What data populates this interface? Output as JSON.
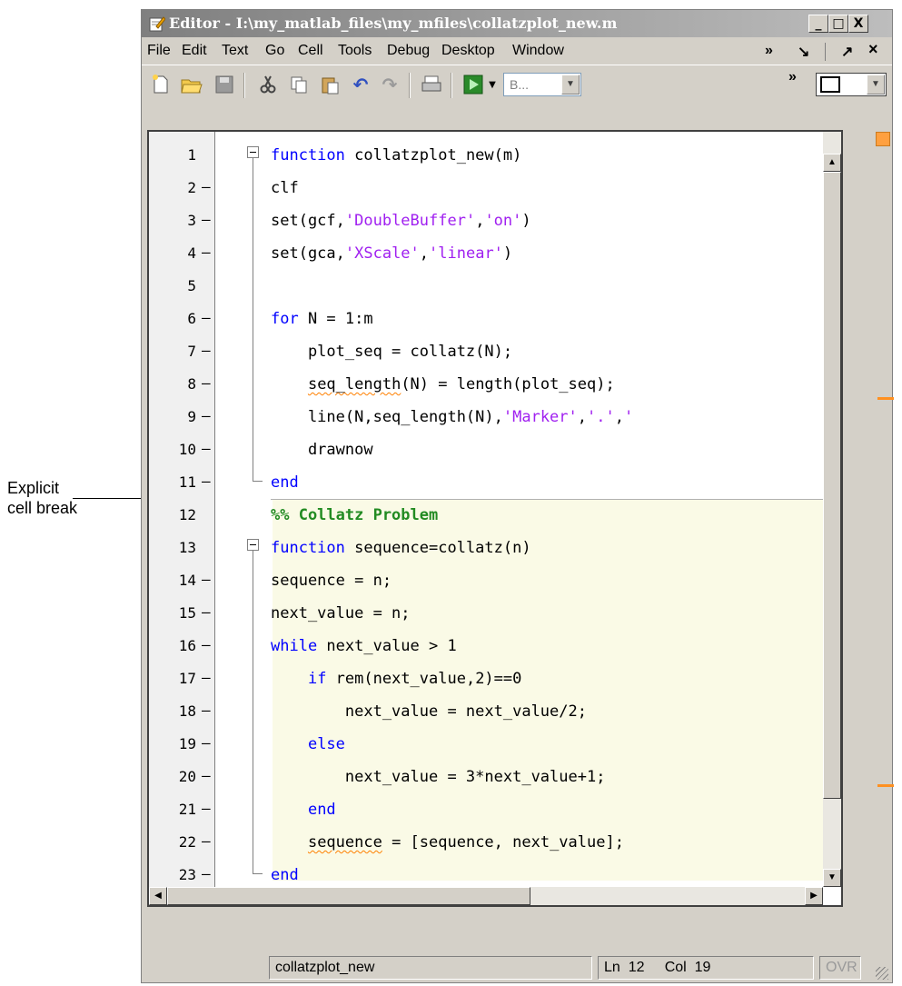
{
  "annotation": {
    "line1": "Explicit",
    "line2": "cell break"
  },
  "window": {
    "title": "Editor - I:\\my_matlab_files\\my_mfiles\\collatzplot_new.m",
    "controls": {
      "minimize": "_",
      "maximize": "□",
      "close": "X"
    }
  },
  "menu": {
    "items": [
      "File",
      "Edit",
      "Text",
      "Go",
      "Cell",
      "Tools",
      "Debug",
      "Desktop",
      "Window"
    ],
    "more": "»",
    "dock": "↘",
    "undock": "↗",
    "close": "×"
  },
  "toolbar": {
    "icons": [
      "new-file-icon",
      "open-folder-icon",
      "save-icon",
      "cut-icon",
      "copy-icon",
      "paste-icon",
      "undo-icon",
      "redo-icon",
      "print-icon",
      "run-icon"
    ],
    "combo_value": "B...",
    "more": "»"
  },
  "code": {
    "lines": [
      {
        "n": "1",
        "dash": "",
        "text": "function collatzplot_new(m)"
      },
      {
        "n": "2",
        "dash": "—",
        "text": "clf"
      },
      {
        "n": "3",
        "dash": "—",
        "text": "set(gcf,'DoubleBuffer','on')"
      },
      {
        "n": "4",
        "dash": "—",
        "text": "set(gca,'XScale','linear')"
      },
      {
        "n": "5",
        "dash": "",
        "text": ""
      },
      {
        "n": "6",
        "dash": "—",
        "text": "for N = 1:m"
      },
      {
        "n": "7",
        "dash": "—",
        "text": "    plot_seq = collatz(N);"
      },
      {
        "n": "8",
        "dash": "—",
        "text": "    seq_length(N) = length(plot_seq);"
      },
      {
        "n": "9",
        "dash": "—",
        "text": "    line(N,seq_length(N),'Marker','.','"
      },
      {
        "n": "10",
        "dash": "—",
        "text": "    drawnow"
      },
      {
        "n": "11",
        "dash": "—",
        "text": "end"
      },
      {
        "n": "12",
        "dash": "",
        "text": "%% Collatz Problem"
      },
      {
        "n": "13",
        "dash": "",
        "text": "function sequence=collatz(n)"
      },
      {
        "n": "14",
        "dash": "—",
        "text": "sequence = n;"
      },
      {
        "n": "15",
        "dash": "—",
        "text": "next_value = n;"
      },
      {
        "n": "16",
        "dash": "—",
        "text": "while next_value > 1"
      },
      {
        "n": "17",
        "dash": "—",
        "text": "    if rem(next_value,2)==0"
      },
      {
        "n": "18",
        "dash": "—",
        "text": "        next_value = next_value/2;"
      },
      {
        "n": "19",
        "dash": "—",
        "text": "    else"
      },
      {
        "n": "20",
        "dash": "—",
        "text": "        next_value = 3*next_value+1;"
      },
      {
        "n": "21",
        "dash": "—",
        "text": "    end"
      },
      {
        "n": "22",
        "dash": "—",
        "text": "    sequence = [sequence, next_value];"
      },
      {
        "n": "23",
        "dash": "—",
        "text": "end"
      }
    ]
  },
  "status": {
    "file": "collatzplot_new",
    "ln_label": "Ln",
    "ln": "12",
    "col_label": "Col",
    "col": "19",
    "mode": "OVR"
  },
  "colors": {
    "keyword": "#0000ff",
    "string": "#a020f0",
    "cell_title": "#228b22",
    "cell_background": "#fafae6",
    "marker": "#ff9020"
  }
}
